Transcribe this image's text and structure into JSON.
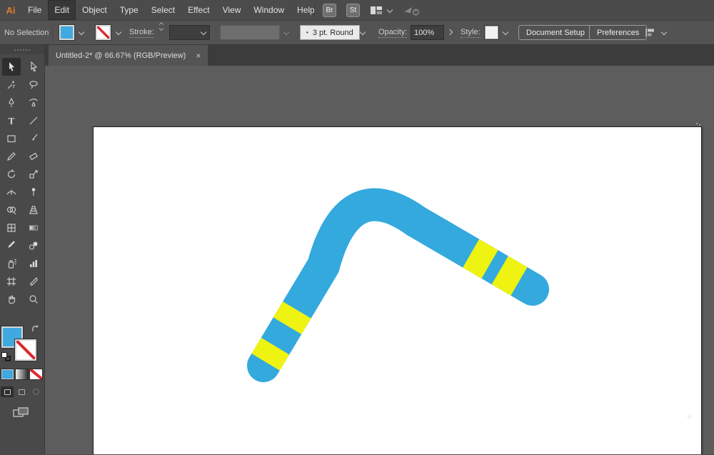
{
  "colors": {
    "accent-orange": "#e07f2c",
    "fill-swatch": "#3fa9e0",
    "none-red": "#d9272e",
    "artwork-blue": "#33a9de",
    "artwork-yellow": "#eff312"
  },
  "menubar": {
    "logo": "Ai",
    "items": [
      {
        "label": "File"
      },
      {
        "label": "Edit"
      },
      {
        "label": "Object"
      },
      {
        "label": "Type"
      },
      {
        "label": "Select"
      },
      {
        "label": "Effect"
      },
      {
        "label": "View"
      },
      {
        "label": "Window"
      },
      {
        "label": "Help"
      }
    ],
    "active_item": "Edit",
    "br_button": "Br",
    "st_button": "St"
  },
  "controlbar": {
    "selection_status": "No Selection",
    "stroke_label": "Stroke:",
    "brush_bullet": "•",
    "brush_value": "3 pt. Round",
    "opacity_label": "Opacity:",
    "opacity_value": "100%",
    "style_label": "Style:",
    "document_setup_button": "Document Setup",
    "preferences_button": "Preferences"
  },
  "document_tab": {
    "title": "Untitled-2* @ 66.67% (RGB/Preview)",
    "close_glyph": "×"
  },
  "toolbar": {
    "tools": [
      "Selection Tool",
      "Direct Selection Tool",
      "Magic Wand Tool",
      "Lasso Tool",
      "Pen Tool",
      "Curvature Tool",
      "Type Tool",
      "Line Segment Tool",
      "Rectangle Tool",
      "Paintbrush Tool",
      "Shaper Tool",
      "Eraser Tool",
      "Rotate Tool",
      "Scale Tool",
      "Width Tool",
      "Puppet Warp Tool",
      "Shape Builder Tool",
      "Perspective Grid Tool",
      "Mesh Tool",
      "Gradient Tool",
      "Eyedropper Tool",
      "Blend Tool",
      "Symbol Sprayer Tool",
      "Column Graph Tool",
      "Artboard Tool",
      "Slice Tool",
      "Hand Tool",
      "Zoom Tool"
    ]
  },
  "artwork": {
    "shape": "boomerang",
    "fill_color": "#33a9de",
    "stripe_color": "#eff312",
    "stripes_per_arm": 2
  }
}
